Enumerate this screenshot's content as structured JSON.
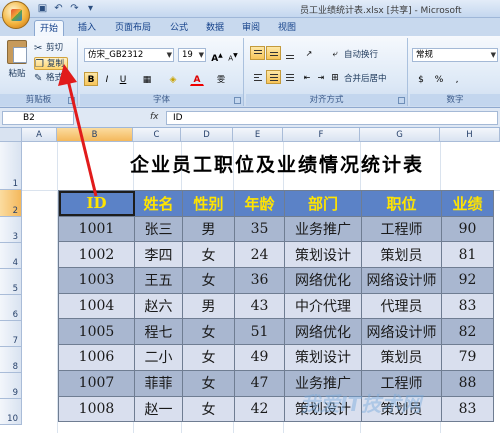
{
  "window": {
    "title": "员工业绩统计表.xlsx [共享] - Microsoft"
  },
  "tabs": [
    "开始",
    "插入",
    "页面布局",
    "公式",
    "数据",
    "审阅",
    "视图"
  ],
  "clipboard": {
    "paste": "粘贴",
    "cut": "剪切",
    "copy": "复制",
    "format_painter": "格式",
    "group": "剪贴板"
  },
  "font": {
    "name": "仿宋_GB2312",
    "size": "19",
    "bold": "B",
    "italic": "I",
    "underline": "U",
    "group": "字体"
  },
  "alignment": {
    "wrap": "自动换行",
    "merge": "合并后居中",
    "group": "对齐方式"
  },
  "number": {
    "format": "常规",
    "group": "数字"
  },
  "formula_bar": {
    "cell": "B2",
    "fx": "fx",
    "value": "ID"
  },
  "columns": [
    "A",
    "B",
    "C",
    "D",
    "E",
    "F",
    "G",
    "H"
  ],
  "rows": [
    "1",
    "2",
    "3",
    "4",
    "5",
    "6",
    "7",
    "8",
    "9",
    "10"
  ],
  "sheet_title": "企业员工职位及业绩情况统计表",
  "table": {
    "headers": [
      "ID",
      "姓名",
      "性别",
      "年龄",
      "部门",
      "职位",
      "业绩"
    ],
    "rows": [
      [
        "1001",
        "张三",
        "男",
        "35",
        "业务推广",
        "工程师",
        "90"
      ],
      [
        "1002",
        "李四",
        "女",
        "24",
        "策划设计",
        "策划员",
        "81"
      ],
      [
        "1003",
        "王五",
        "女",
        "36",
        "网络优化",
        "网络设计师",
        "92"
      ],
      [
        "1004",
        "赵六",
        "男",
        "43",
        "中介代理",
        "代理员",
        "83"
      ],
      [
        "1005",
        "程七",
        "女",
        "51",
        "网络优化",
        "网络设计师",
        "82"
      ],
      [
        "1006",
        "二小",
        "女",
        "49",
        "策划设计",
        "策划员",
        "79"
      ],
      [
        "1007",
        "菲菲",
        "女",
        "47",
        "业务推广",
        "工程师",
        "88"
      ],
      [
        "1008",
        "赵一",
        "女",
        "42",
        "策划设计",
        "策划员",
        "83"
      ]
    ]
  },
  "watermark": "我爱IT技术网",
  "colors": {
    "header_bg": "#5b82c7",
    "header_text": "#ffe400",
    "row_dark": "#a9b7d0",
    "row_light": "#d9dfee",
    "arrow": "#e11b1b"
  }
}
